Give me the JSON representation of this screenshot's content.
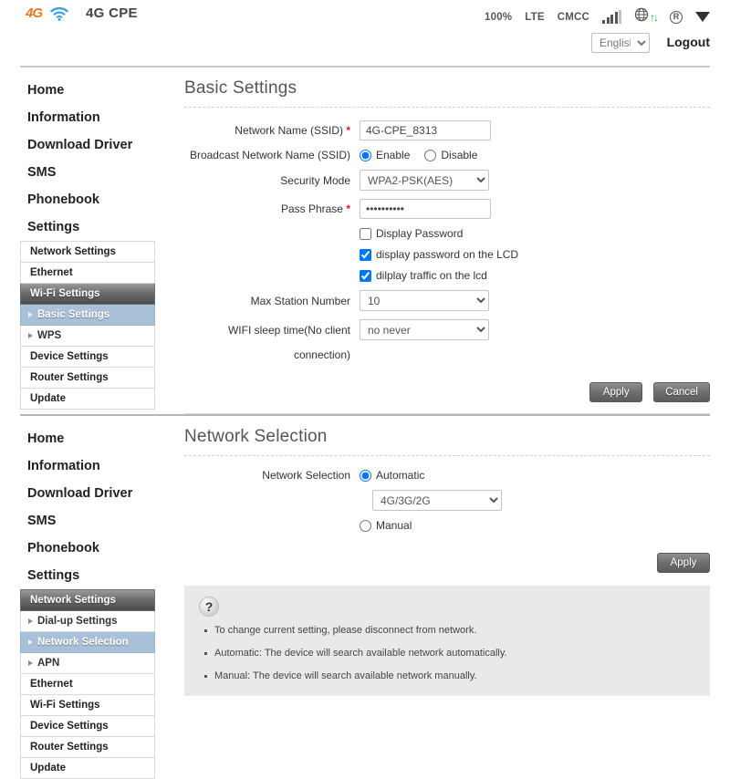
{
  "header": {
    "logo_4g": "4G",
    "logo_wifi_icon": "wifi-icon",
    "title": "4G CPE",
    "status": {
      "battery": "100%",
      "network_type": "LTE",
      "carrier": "CMCC",
      "signal_icon": "signal-bars-icon",
      "globe_icon": "globe-icon",
      "traffic_icon": "up-down-arrows-icon",
      "roaming_icon": "registered-r-icon",
      "wifi_status_icon": "triangle-down-icon"
    },
    "language": "English",
    "language_options": [
      "English"
    ],
    "logout": "Logout"
  },
  "panel1": {
    "sidebar": {
      "top_items": [
        "Home",
        "Information",
        "Download Driver",
        "SMS",
        "Phonebook",
        "Settings"
      ],
      "sub_items": [
        {
          "label": "Network Settings",
          "type": "group",
          "active": false
        },
        {
          "label": "Ethernet",
          "type": "group",
          "active": false
        },
        {
          "label": "Wi-Fi Settings",
          "type": "group",
          "active": true
        },
        {
          "label": "Basic Settings",
          "type": "leaf",
          "active": true
        },
        {
          "label": "WPS",
          "type": "leaf",
          "active": false
        },
        {
          "label": "Device Settings",
          "type": "group",
          "active": false
        },
        {
          "label": "Router Settings",
          "type": "group",
          "active": false
        },
        {
          "label": "Update",
          "type": "group",
          "active": false
        }
      ]
    },
    "title": "Basic Settings",
    "fields": {
      "ssid_label": "Network Name (SSID)",
      "ssid_value": "4G-CPE_8313",
      "broadcast_label": "Broadcast Network Name (SSID)",
      "broadcast_enable": "Enable",
      "broadcast_disable": "Disable",
      "broadcast_selected": "Enable",
      "security_label": "Security Mode",
      "security_value": "WPA2-PSK(AES)",
      "security_options": [
        "WPA2-PSK(AES)"
      ],
      "passphrase_label": "Pass Phrase",
      "passphrase_value": "••••••••••",
      "display_password_label": "Display Password",
      "display_password_checked": false,
      "display_password_lcd_label": "display password on the LCD",
      "display_password_lcd_checked": true,
      "display_traffic_lcd_label": "dilplay traffic on the lcd",
      "display_traffic_lcd_checked": true,
      "max_station_label": "Max Station Number",
      "max_station_value": "10",
      "max_station_options": [
        "10"
      ],
      "sleep_label_line1": "WIFI sleep time(No client",
      "sleep_label_line2": "connection)",
      "sleep_value": "no never",
      "sleep_options": [
        "no never"
      ]
    },
    "buttons": {
      "apply": "Apply",
      "cancel": "Cancel"
    }
  },
  "panel2": {
    "sidebar": {
      "top_items": [
        "Home",
        "Information",
        "Download Driver",
        "SMS",
        "Phonebook",
        "Settings"
      ],
      "sub_items": [
        {
          "label": "Network Settings",
          "type": "group",
          "active": true
        },
        {
          "label": "Dial-up Settings",
          "type": "leaf",
          "active": false
        },
        {
          "label": "Network Selection",
          "type": "leaf",
          "active": true
        },
        {
          "label": "APN",
          "type": "leaf",
          "active": false
        },
        {
          "label": "Ethernet",
          "type": "group",
          "active": false
        },
        {
          "label": "Wi-Fi Settings",
          "type": "group",
          "active": false
        },
        {
          "label": "Device Settings",
          "type": "group",
          "active": false
        },
        {
          "label": "Router Settings",
          "type": "group",
          "active": false
        },
        {
          "label": "Update",
          "type": "group",
          "active": false
        }
      ]
    },
    "title": "Network Selection",
    "fields": {
      "selection_label": "Network Selection",
      "automatic_label": "Automatic",
      "manual_label": "Manual",
      "selected_mode": "Automatic",
      "mode_value": "4G/3G/2G",
      "mode_options": [
        "4G/3G/2G"
      ]
    },
    "buttons": {
      "apply": "Apply"
    },
    "help": {
      "icon": "question-mark-icon",
      "lines": [
        "To change current setting, please disconnect from network.",
        "Automatic: The device will search available network automatically.",
        "Manual: The device will search available network manually."
      ]
    }
  }
}
